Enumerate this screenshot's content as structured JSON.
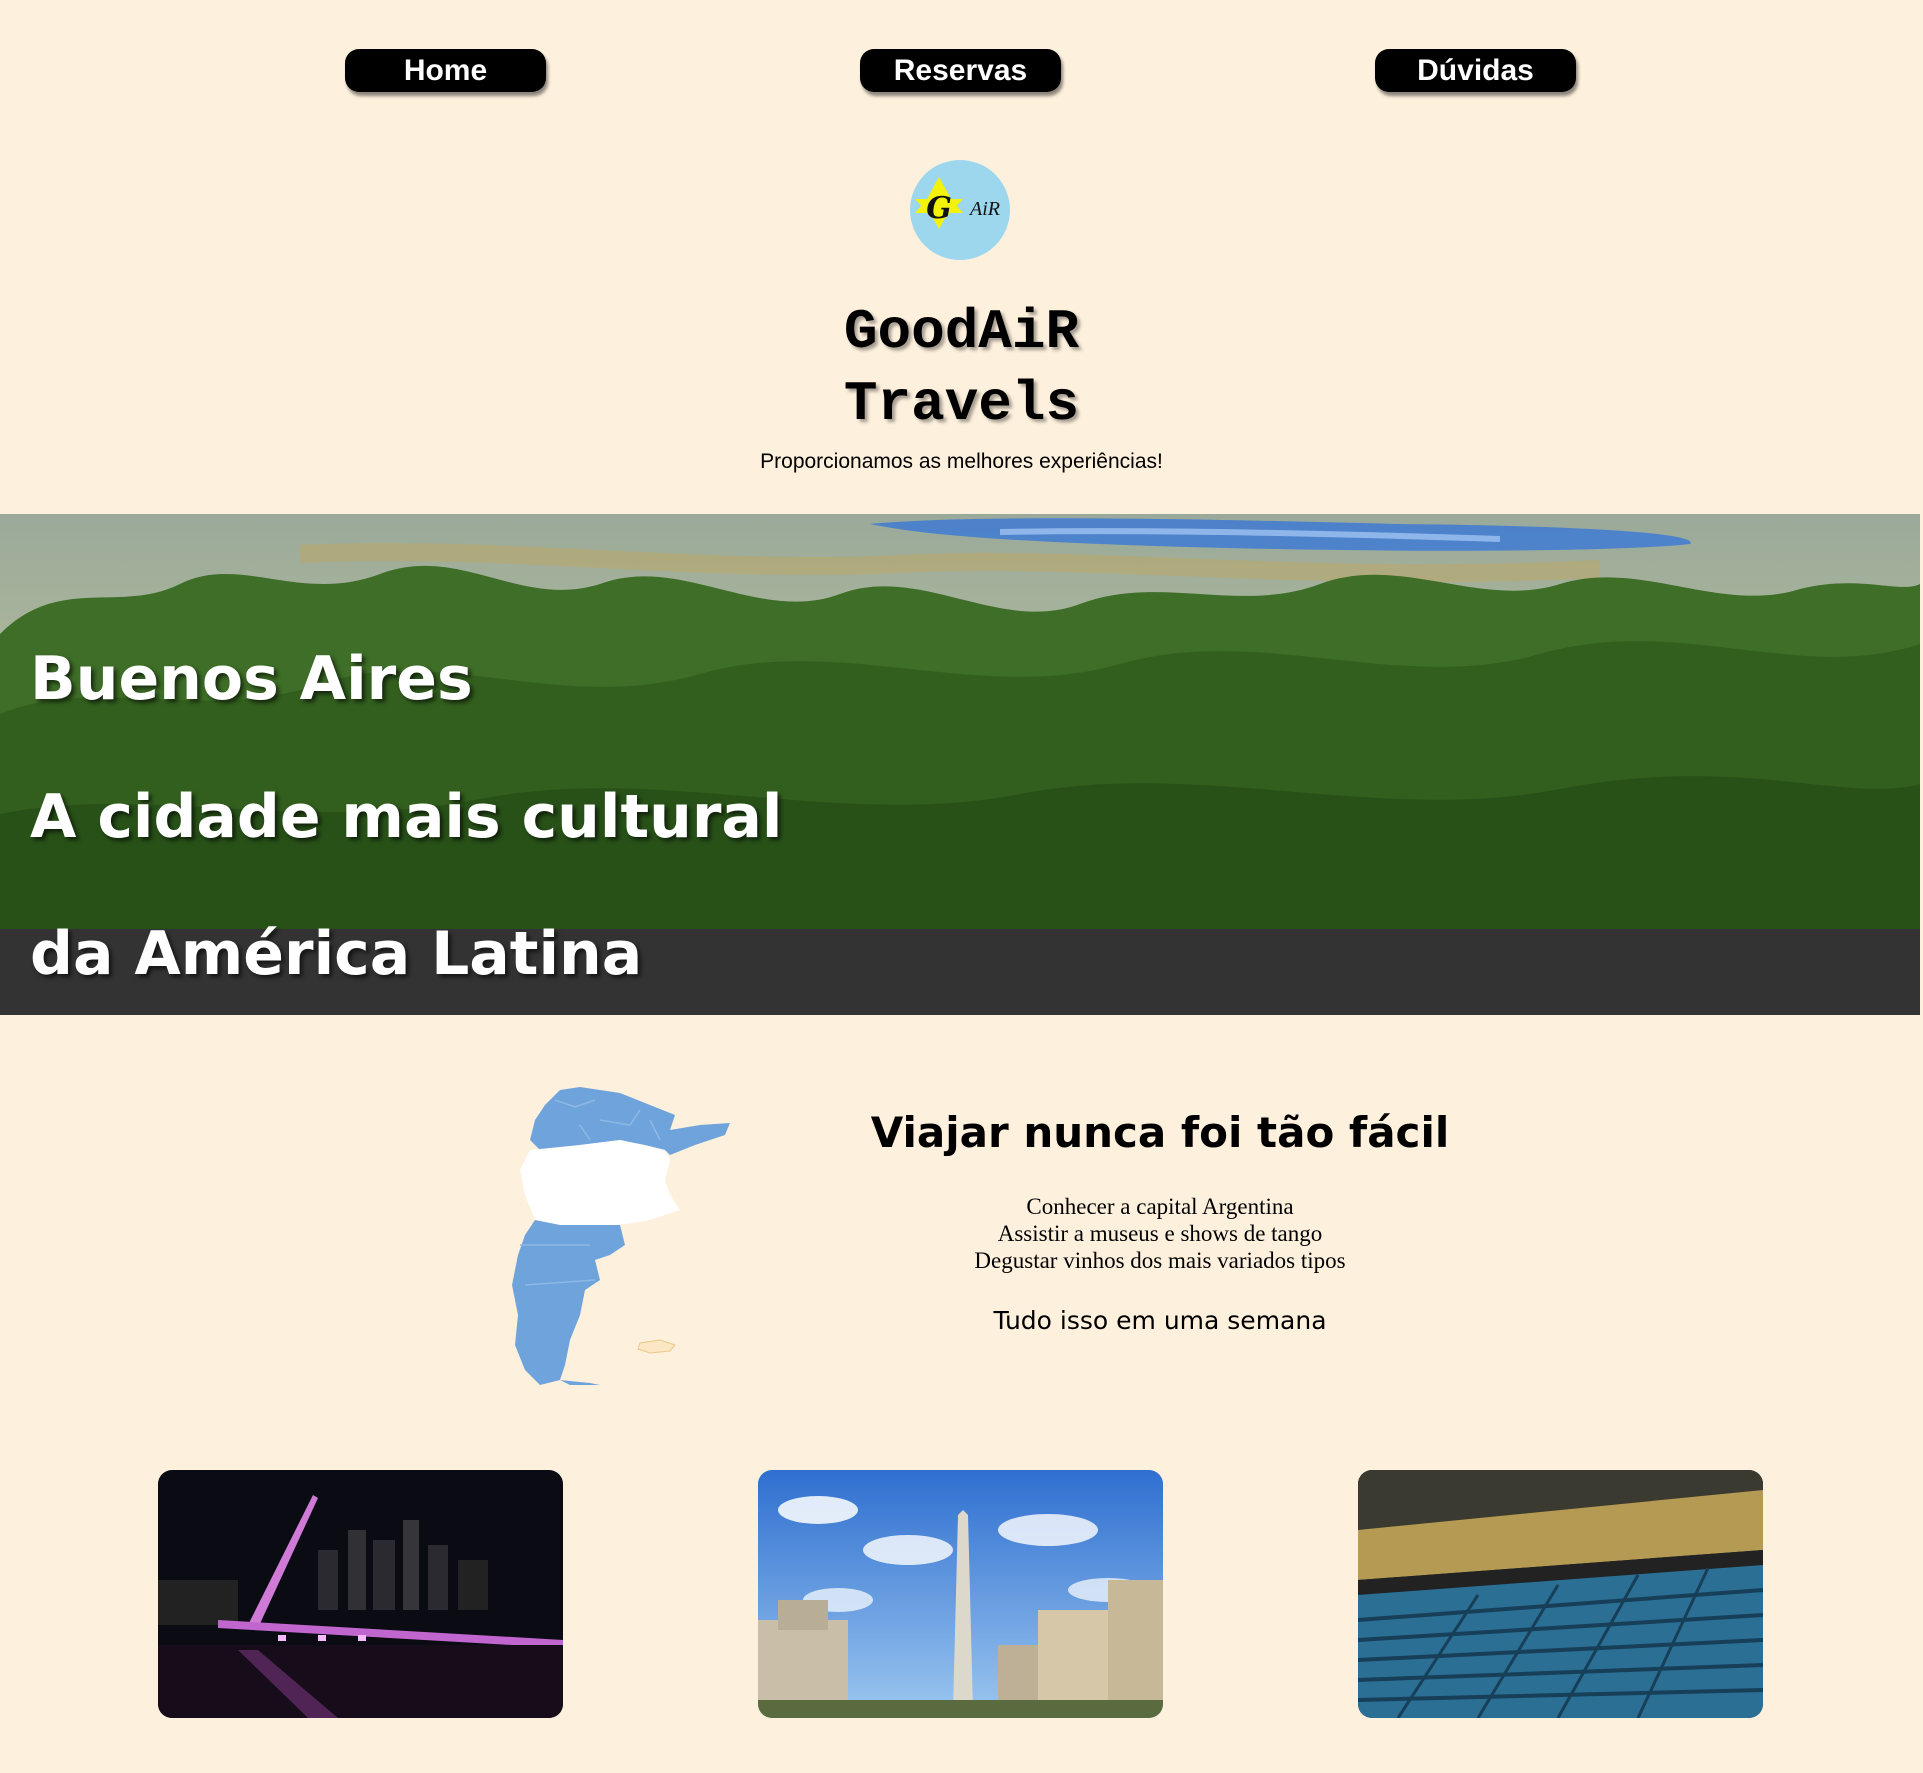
{
  "nav": {
    "home": "Home",
    "reservas": "Reservas",
    "duvidas": "Dúvidas"
  },
  "logo": {
    "letter": "G",
    "text": "AiR"
  },
  "header": {
    "title_line1": "GoodAiR",
    "title_line2": "Travels",
    "tagline": "Proporcionamos as melhores experiências!"
  },
  "hero": {
    "line1": "Buenos Aires",
    "line2": "A cidade mais cultural",
    "line3": "da América Latina"
  },
  "info": {
    "title": "Viajar nunca foi tão fácil",
    "items": [
      "Conhecer a capital Argentina",
      "Assistir a museus e shows de tango",
      "Degustar vinhos dos mais variados tipos"
    ],
    "footer": "Tudo isso em uma semana"
  },
  "colors": {
    "background": "#fdf0dd",
    "nav_button": "#000000",
    "map_blue": "#6fa3dc",
    "hero_band": "#333333"
  },
  "icons": {
    "map": "argentina-map-icon",
    "logo": "star-logo-icon"
  }
}
